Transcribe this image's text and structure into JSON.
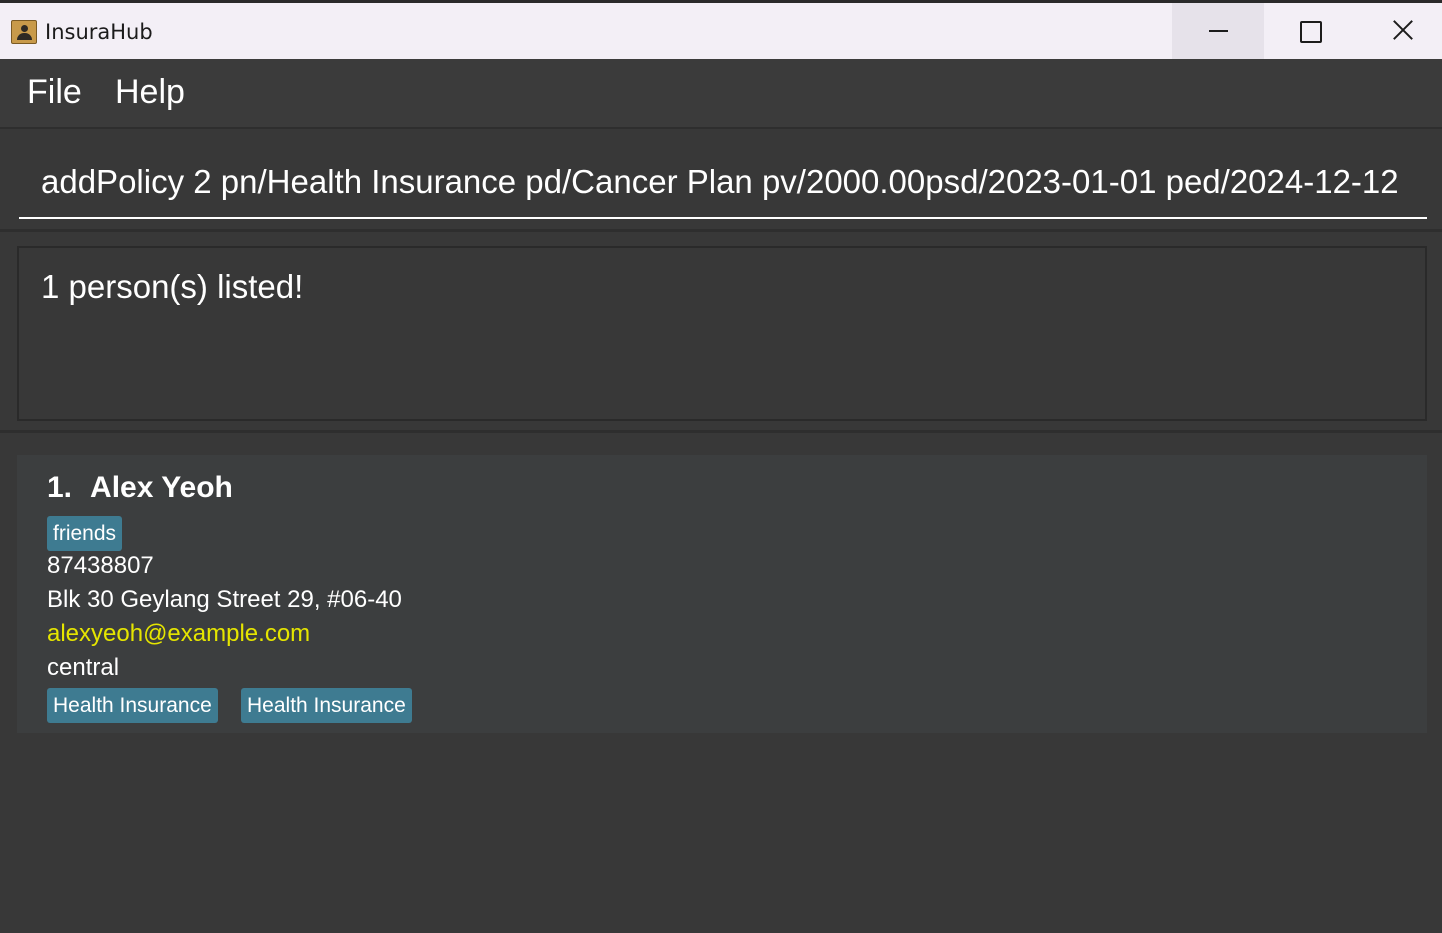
{
  "window": {
    "title": "InsuraHub",
    "icon": "address-book-icon"
  },
  "menu": {
    "items": [
      {
        "label": "File"
      },
      {
        "label": "Help"
      }
    ]
  },
  "command": {
    "value": "addPolicy 2 pn/Health Insurance pd/Cancer Plan pv/2000.00psd/2023-01-01 ped/2024-12-12"
  },
  "result": {
    "message": "1 person(s) listed!"
  },
  "persons": [
    {
      "index": "1.",
      "name": "Alex Yeoh",
      "tags": [
        "friends"
      ],
      "phone": "87438807",
      "address": "Blk 30 Geylang Street 29, #06-40",
      "email": "alexyeoh@example.com",
      "region": "central",
      "policies": [
        "Health Insurance",
        "Health Insurance"
      ]
    }
  ],
  "colors": {
    "background": "#383838",
    "tag": "#3e7b91",
    "email": "#e5e500"
  }
}
